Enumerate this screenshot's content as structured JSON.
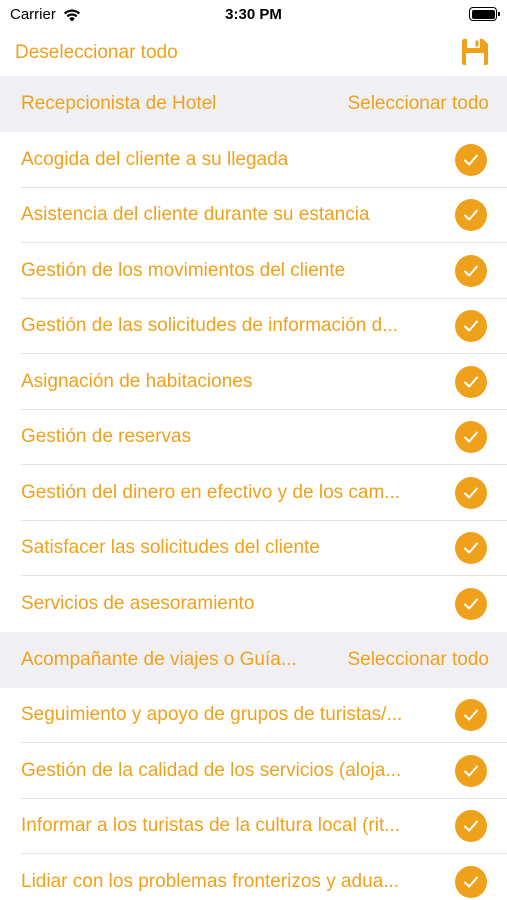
{
  "status": {
    "carrier": "Carrier",
    "time": "3:30 PM"
  },
  "nav": {
    "deselect_label": "Deseleccionar todo",
    "save_icon": "floppy-disk-icon"
  },
  "colors": {
    "accent": "#f0a11b",
    "section_bg": "#efeff4"
  },
  "sections": [
    {
      "title": "Recepcionista de Hotel",
      "select_all": "Seleccionar todo",
      "items": [
        {
          "label": "Acogida del cliente a su llegada",
          "checked": true
        },
        {
          "label": "Asistencia del cliente durante su estancia",
          "checked": true
        },
        {
          "label": "Gestión de los movimientos del cliente",
          "checked": true
        },
        {
          "label": "Gestión de las solicitudes de información d...",
          "checked": true
        },
        {
          "label": "Asignación de habitaciones",
          "checked": true
        },
        {
          "label": "Gestión de reservas",
          "checked": true
        },
        {
          "label": "Gestión del dinero en efectivo y de los cam...",
          "checked": true
        },
        {
          "label": "Satisfacer las solicitudes del cliente",
          "checked": true
        },
        {
          "label": "Servicios de asesoramiento",
          "checked": true
        }
      ]
    },
    {
      "title": "Acompañante de viajes o Guía...",
      "select_all": "Seleccionar todo",
      "items": [
        {
          "label": "Seguimiento y apoyo de grupos de turistas/...",
          "checked": true
        },
        {
          "label": "Gestión de la calidad de los servicios (aloja...",
          "checked": true
        },
        {
          "label": "Informar a los turistas de la cultura local (rit...",
          "checked": true
        },
        {
          "label": "Lidiar con los problemas fronterizos y adua...",
          "checked": true
        }
      ]
    }
  ]
}
